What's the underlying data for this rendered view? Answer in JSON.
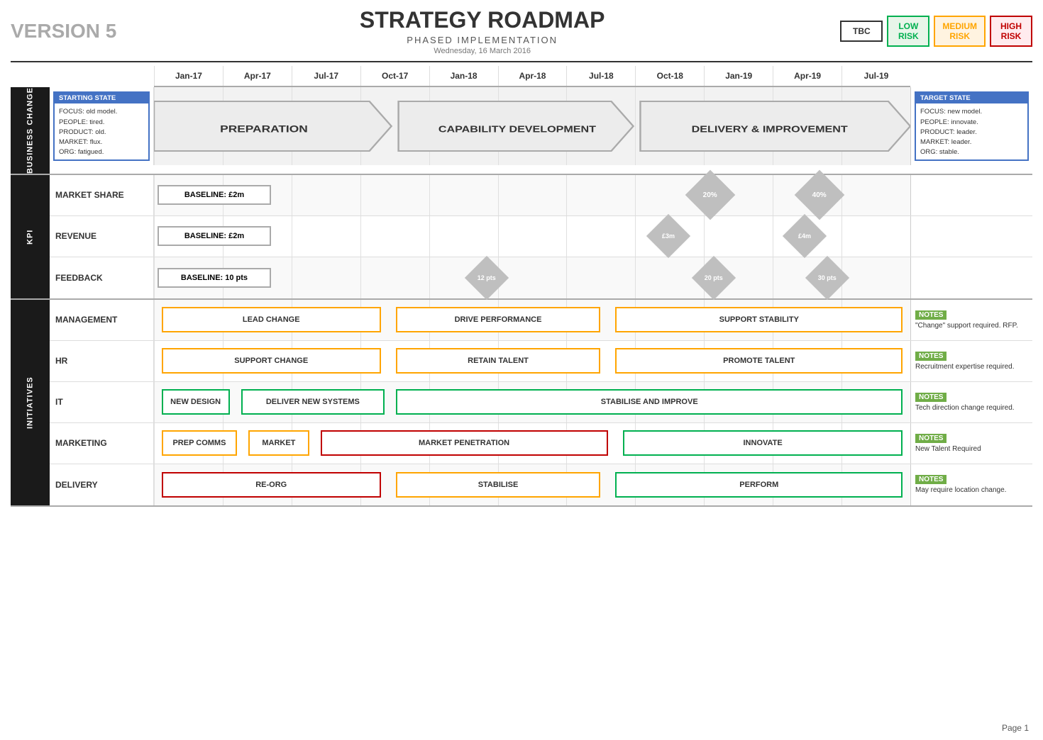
{
  "header": {
    "version": "VERSION 5",
    "title": "STRATEGY ROADMAP",
    "subtitle": "PHASED IMPLEMENTATION",
    "date": "Wednesday, 16 March 2016"
  },
  "risk_badges": [
    {
      "label": "TBC",
      "class": "risk-tbc"
    },
    {
      "label": "LOW\nRISK",
      "class": "risk-low"
    },
    {
      "label": "MEDIUM\nRISK",
      "class": "risk-medium"
    },
    {
      "label": "HIGH\nRISK",
      "class": "risk-high"
    }
  ],
  "timeline_cols": [
    "Jan-17",
    "Apr-17",
    "Jul-17",
    "Oct-17",
    "Jan-18",
    "Apr-18",
    "Jul-18",
    "Oct-18",
    "Jan-19",
    "Apr-19",
    "Jul-19"
  ],
  "sections": {
    "business_change": {
      "label": "BUSINESS CHANGE",
      "starting_state": {
        "header": "STARTING STATE",
        "lines": [
          "FOCUS: old model.",
          "PEOPLE: tired.",
          "PRODUCT: old.",
          "MARKET: flux.",
          "ORG: fatigued."
        ]
      },
      "arrows": [
        {
          "label": "PREPARATION",
          "width_pct": 29
        },
        {
          "label": "CAPABILITY DEVELOPMENT",
          "width_pct": 31
        },
        {
          "label": "DELIVERY & IMPROVEMENT",
          "width_pct": 40
        }
      ],
      "target_state": {
        "header": "TARGET STATE",
        "lines": [
          "FOCUS: new model.",
          "PEOPLE: innovate.",
          "PRODUCT: leader.",
          "MARKET: leader.",
          "ORG: stable."
        ]
      }
    },
    "kpi": {
      "label": "KPI",
      "rows": [
        {
          "name": "MARKET SHARE",
          "baseline": "BASELINE: £2m",
          "milestones": [
            {
              "label": "20%",
              "pos_pct": 73.5,
              "type": "diamond"
            },
            {
              "label": "40%",
              "pos_pct": 88,
              "type": "diamond"
            }
          ]
        },
        {
          "name": "REVENUE",
          "baseline": "BASELINE: £2m",
          "milestones": [
            {
              "label": "£3m",
              "pos_pct": 68,
              "type": "diamond"
            },
            {
              "label": "£4m",
              "pos_pct": 86,
              "type": "diamond"
            }
          ]
        },
        {
          "name": "FEEDBACK",
          "baseline": "BASELINE: 10 pts",
          "milestones": [
            {
              "label": "12 pts",
              "pos_pct": 44,
              "type": "diamond"
            },
            {
              "label": "20 pts",
              "pos_pct": 74,
              "type": "diamond"
            },
            {
              "label": "30 pts",
              "pos_pct": 89,
              "type": "diamond"
            }
          ]
        }
      ]
    },
    "initiatives": {
      "label": "INITIATIVES",
      "rows": [
        {
          "name": "MANAGEMENT",
          "boxes": [
            {
              "label": "LEAD CHANGE",
              "left_pct": 0,
              "width_pct": 31,
              "color": "bo"
            },
            {
              "label": "DRIVE PERFORMANCE",
              "left_pct": 33,
              "width_pct": 27,
              "color": "bo"
            },
            {
              "label": "SUPPORT STABILITY",
              "left_pct": 62,
              "width_pct": 38,
              "color": "bo"
            }
          ],
          "notes": {
            "header": "NOTES",
            "text": "\"Change\" support required. RFP."
          }
        },
        {
          "name": "HR",
          "boxes": [
            {
              "label": "SUPPORT CHANGE",
              "left_pct": 0,
              "width_pct": 31,
              "color": "bo"
            },
            {
              "label": "RETAIN TALENT",
              "left_pct": 33,
              "width_pct": 27,
              "color": "bo"
            },
            {
              "label": "PROMOTE TALENT",
              "left_pct": 62,
              "width_pct": 38,
              "color": "bo"
            }
          ],
          "notes": {
            "header": "NOTES",
            "text": "Recruitment expertise required."
          }
        },
        {
          "name": "IT",
          "boxes": [
            {
              "label": "NEW DESIGN",
              "left_pct": 0,
              "width_pct": 10,
              "color": "bg"
            },
            {
              "label": "DELIVER NEW SYSTEMS",
              "left_pct": 12,
              "width_pct": 19,
              "color": "bg"
            },
            {
              "label": "STABILISE AND IMPROVE",
              "left_pct": 33,
              "width_pct": 67,
              "color": "bg"
            }
          ],
          "notes": {
            "header": "NOTES",
            "text": "Tech direction change required."
          }
        },
        {
          "name": "MARKETING",
          "boxes": [
            {
              "label": "PREP COMMS",
              "left_pct": 0,
              "width_pct": 11,
              "color": "bo"
            },
            {
              "label": "MARKET",
              "left_pct": 13,
              "width_pct": 8,
              "color": "bo"
            },
            {
              "label": "MARKET PENETRATION",
              "left_pct": 23,
              "width_pct": 37,
              "color": "br"
            },
            {
              "label": "INNOVATE",
              "left_pct": 62,
              "width_pct": 38,
              "color": "bg"
            }
          ],
          "notes": {
            "header": "NOTES",
            "text": "New Talent Required"
          }
        },
        {
          "name": "DELIVERY",
          "boxes": [
            {
              "label": "RE-ORG",
              "left_pct": 0,
              "width_pct": 31,
              "color": "br"
            },
            {
              "label": "STABILISE",
              "left_pct": 33,
              "width_pct": 27,
              "color": "bo"
            },
            {
              "label": "PERFORM",
              "left_pct": 62,
              "width_pct": 38,
              "color": "bg"
            }
          ],
          "notes": {
            "header": "NOTES",
            "text": "May require location change."
          }
        }
      ]
    }
  },
  "page": "Page 1"
}
